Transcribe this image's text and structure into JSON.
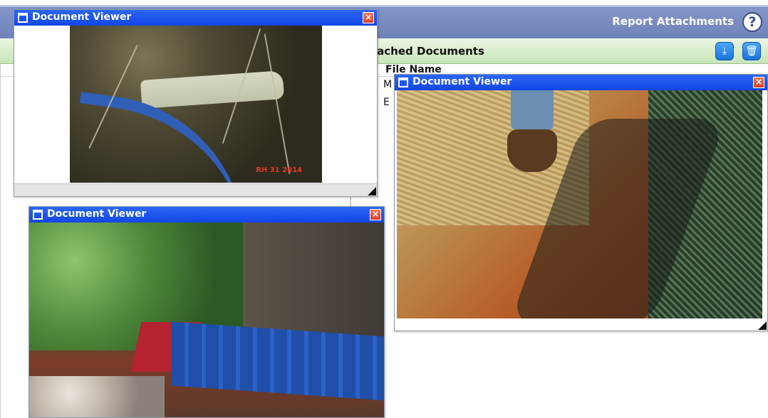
{
  "app": {
    "header_title": "Report Attachments",
    "help_icon": "help-icon",
    "section_label": "tached Documents",
    "table": {
      "column_file_name": "File Name",
      "rows": [
        "M",
        "E"
      ]
    },
    "toolbar": {
      "download_icon": "download-icon",
      "delete_icon": "trash-icon"
    }
  },
  "windows": [
    {
      "title": "Document Viewer",
      "close_icon": "close-icon",
      "photo_stamp": "RH 31 2014"
    },
    {
      "title": "Document Viewer",
      "close_icon": "close-icon"
    },
    {
      "title": "Document Viewer",
      "close_icon": "close-icon"
    }
  ],
  "colors": {
    "titlebar_blue": "#1a4ff0",
    "header_blue": "#7b8ec4",
    "section_green": "#cfe8c0"
  }
}
